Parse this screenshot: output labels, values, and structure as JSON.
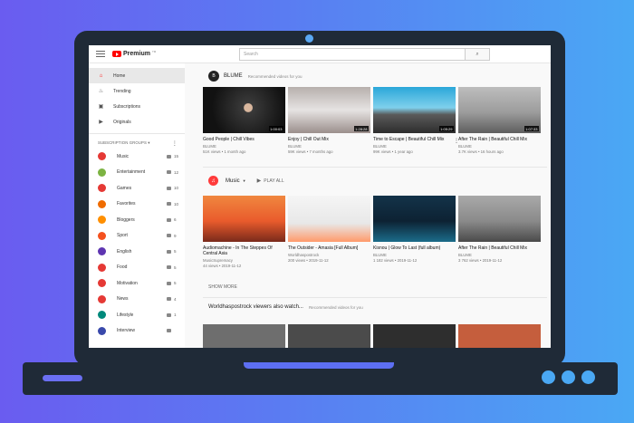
{
  "topbar": {
    "logo_text": "Premium",
    "logo_sup": "TM",
    "search_placeholder": "Search",
    "search_icon": "search-icon"
  },
  "sidebar": {
    "nav": [
      {
        "label": "Home",
        "icon": "home-icon",
        "active": true
      },
      {
        "label": "Trending",
        "icon": "flame-icon"
      },
      {
        "label": "Subscriptions",
        "icon": "subscriptions-icon"
      },
      {
        "label": "Originals",
        "icon": "originals-icon"
      }
    ],
    "group_title": "SUBSCRIPTION GROUPS ▾",
    "groups": [
      {
        "label": "Music",
        "count": "15",
        "color": "#e53935"
      },
      {
        "label": "Entertainment",
        "count": "12",
        "color": "#7cb342"
      },
      {
        "label": "Games",
        "count": "10",
        "color": "#e53935"
      },
      {
        "label": "Favorites",
        "count": "10",
        "color": "#ef6c00"
      },
      {
        "label": "Bloggers",
        "count": "6",
        "color": "#ff8f00"
      },
      {
        "label": "Sport",
        "count": "9",
        "color": "#f4511e"
      },
      {
        "label": "English",
        "count": "5",
        "color": "#5e35b1"
      },
      {
        "label": "Food",
        "count": "5",
        "color": "#e53935"
      },
      {
        "label": "Motivation",
        "count": "5",
        "color": "#e53935"
      },
      {
        "label": "News",
        "count": "4",
        "color": "#e53935"
      },
      {
        "label": "Lifestyle",
        "count": "1",
        "color": "#00897b"
      },
      {
        "label": "Interview",
        "count": "",
        "color": "#3949ab"
      }
    ]
  },
  "main": {
    "blume": {
      "avatar": "B",
      "title": "BLUME",
      "subtitle": "Recommended videos for you",
      "videos": [
        {
          "title": "Good People | Chill Vibes",
          "channel": "BLUME",
          "meta": "51K views • 1 month ago",
          "duration": "1:00:03"
        },
        {
          "title": "Enjoy | Chill Out Mix",
          "channel": "BLUME",
          "meta": "59K views • 7 months ago",
          "duration": "1:28:28"
        },
        {
          "title": "Time to Escape | Beautiful Chill Mix",
          "channel": "BLUME",
          "meta": "99K views • 1 year ago",
          "duration": "1:05:29"
        },
        {
          "title": "After The Rain | Beautiful Chill Mix",
          "channel": "BLUME",
          "meta": "3.7K views • 16 hours ago",
          "duration": "1:07:33"
        }
      ]
    },
    "music": {
      "label": "Music",
      "play_all": "PLAY ALL",
      "videos": [
        {
          "title": "Audiomachine - In The Steppes Of Central Asia",
          "channel": "MusicSupremacy",
          "meta": "44 views • 2019-11-12"
        },
        {
          "title": "The Outsider - Amasia [Full Album]",
          "channel": "Worldhaspostrock",
          "meta": "200 views • 2019-11-12"
        },
        {
          "title": "Kisnou | Glow To Last (full album)",
          "channel": "BLUME",
          "meta": "1 182 views • 2019-11-12"
        },
        {
          "title": "After The Rain | Beautiful Chill Mix",
          "channel": "BLUME",
          "meta": "3 762 views • 2019-11-12"
        }
      ],
      "show_more": "SHOW MORE"
    },
    "also_watch": {
      "title": "Worldhaspostrock viewers also watch...",
      "subtitle": "Recommended videos for you"
    }
  }
}
